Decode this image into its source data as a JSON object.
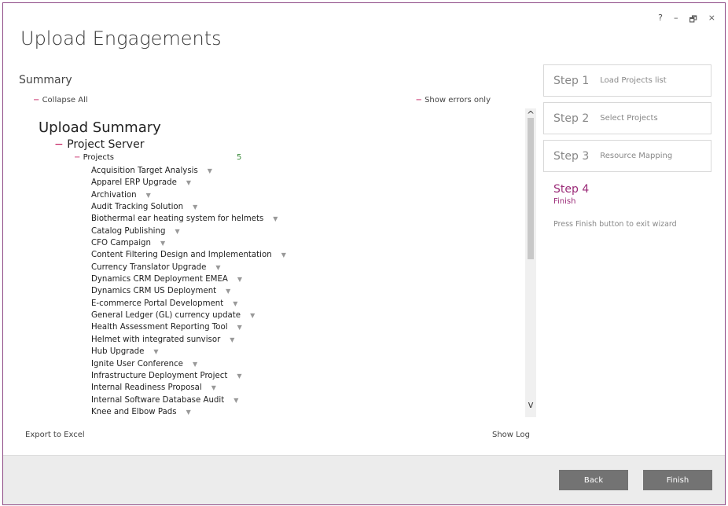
{
  "window_controls": {
    "help": "?",
    "minimize": "–",
    "restore": "🗗",
    "close": "×"
  },
  "app_title": "Upload Engagements",
  "summary": {
    "section_title": "Summary",
    "collapse_all": "Collapse All",
    "show_errors_only": "Show errors only",
    "upload_summary": "Upload Summary",
    "project_server": "Project Server",
    "projects_label": "Projects",
    "projects_count": "5",
    "projects": [
      "Acquisition Target Analysis",
      "Apparel ERP Upgrade",
      "Archivation",
      "Audit Tracking Solution",
      "Biothermal ear heating system for helmets",
      "Catalog Publishing",
      "CFO Campaign",
      "Content Filtering Design and Implementation",
      "Currency Translator Upgrade",
      "Dynamics CRM Deployment EMEA",
      "Dynamics CRM US Deployment",
      "E-commerce Portal Development",
      "General Ledger (GL) currency update",
      "Health Assessment Reporting Tool",
      "Helmet with integrated sunvisor",
      "Hub Upgrade",
      "Ignite User Conference",
      "Infrastructure Deployment Project",
      "Internal Readiness Proposal",
      "Internal Software Database Audit",
      "Knee and Elbow Pads"
    ],
    "export_to_excel": "Export to Excel",
    "show_log": "Show Log"
  },
  "steps": [
    {
      "num": "Step 1",
      "label": "Load Projects list"
    },
    {
      "num": "Step 2",
      "label": "Select Projects"
    },
    {
      "num": "Step 3",
      "label": "Resource Mapping"
    }
  ],
  "current_step": {
    "num": "Step 4",
    "label": "Finish",
    "description": "Press Finish button to exit wizard"
  },
  "footer": {
    "back": "Back",
    "finish": "Finish"
  },
  "colors": {
    "accent": "#9b2b78",
    "button_bg": "#737373",
    "count_green": "#3a8a3a"
  }
}
